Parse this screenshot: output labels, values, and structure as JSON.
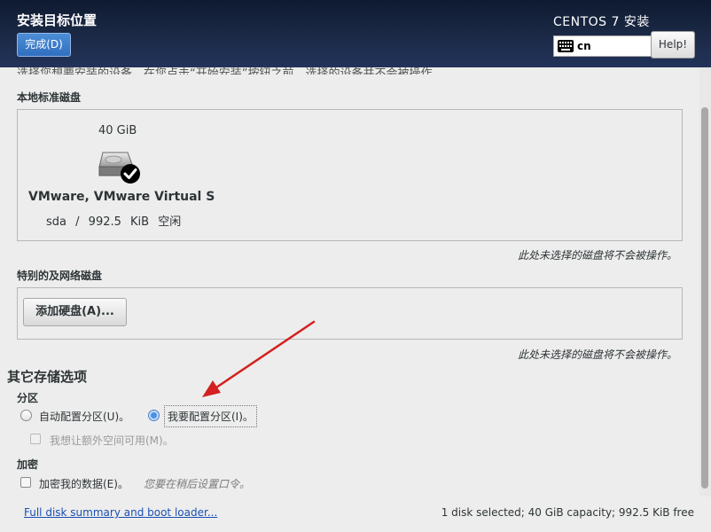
{
  "header": {
    "title": "安装目标位置",
    "done_label": "完成(D)",
    "product": "CENTOS 7 安装",
    "keyboard_layout": "cn",
    "help_label": "Help!"
  },
  "intro_text_cut": "选择您想要安装的设备。在您点击“开始安装”按钮之前，选择的设备并不会被操作。",
  "local_disks": {
    "label": "本地标准磁盘",
    "disk": {
      "size": "40 GiB",
      "name": "VMware, VMware Virtual S",
      "device": "sda",
      "separator": "/",
      "free": "992.5 KiB 空闲",
      "selected": true
    },
    "note": "此处未选择的磁盘将不会被操作。"
  },
  "special_disks": {
    "label": "特别的及网络磁盘",
    "add_button": "添加硬盘(A)...",
    "note": "此处未选择的磁盘将不会被操作。"
  },
  "other_options": {
    "title": "其它存储选项",
    "partitioning": {
      "label": "分区",
      "auto": "自动配置分区(U)。",
      "manual": "我要配置分区(I)。",
      "selected": "manual",
      "extra_space": "我想让额外空间可用(M)。"
    },
    "encryption": {
      "label": "加密",
      "encrypt": "加密我的数据(E)。",
      "hint": "您要在稍后设置口令。"
    }
  },
  "footer": {
    "link": "Full disk summary and boot loader...",
    "status": "1 disk selected; 40 GiB capacity; 992.5 KiB free"
  },
  "colors": {
    "header_bg": "#1c2a47",
    "accent_blue": "#2f6fbf",
    "arrow_red": "#d42020",
    "link": "#1a4fb5"
  }
}
